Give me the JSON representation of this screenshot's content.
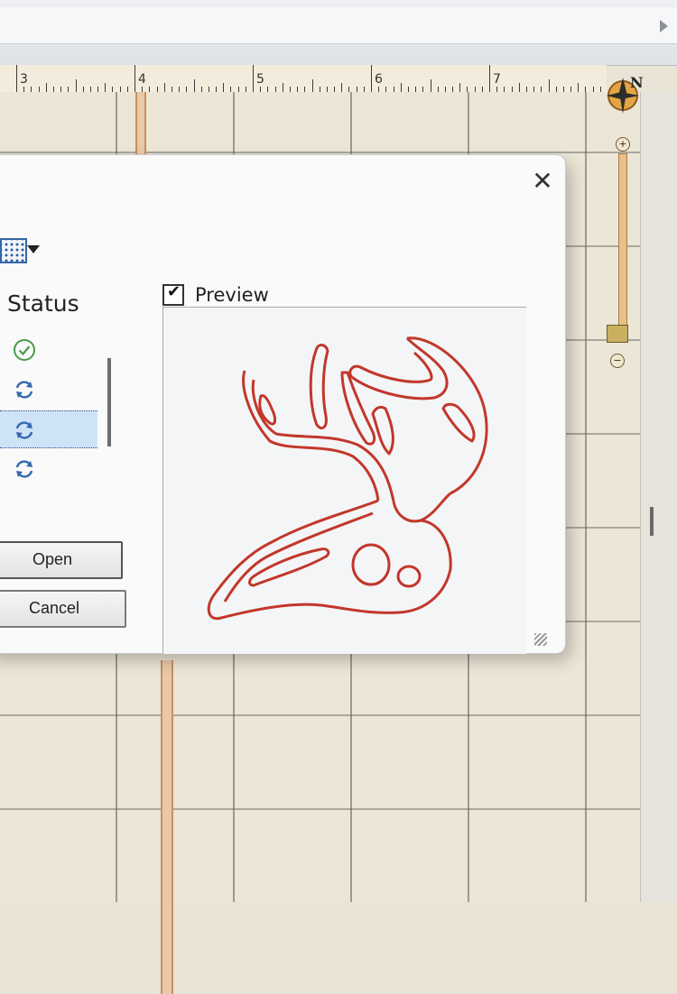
{
  "ruler": {
    "numbers": [
      "3",
      "4",
      "5",
      "6",
      "7"
    ]
  },
  "compass": {
    "north_label": "N"
  },
  "zoom": {
    "plus_label": "+",
    "minus_label": "−"
  },
  "dialog": {
    "close_label": "✕",
    "status_header": "Status",
    "status_items": [
      {
        "icon": "check-circle-icon"
      },
      {
        "icon": "sync-icon"
      },
      {
        "icon": "sync-icon",
        "selected": true
      },
      {
        "icon": "sync-icon"
      }
    ],
    "open_button": "Open",
    "cancel_button": "Cancel",
    "preview_checkbox": {
      "label": "Preview",
      "checked": true
    }
  },
  "colors": {
    "preview_stroke": "#c2372a",
    "selection": "#cfe3f7",
    "status_ok": "#4b9a4b",
    "status_sync": "#3569b0"
  }
}
